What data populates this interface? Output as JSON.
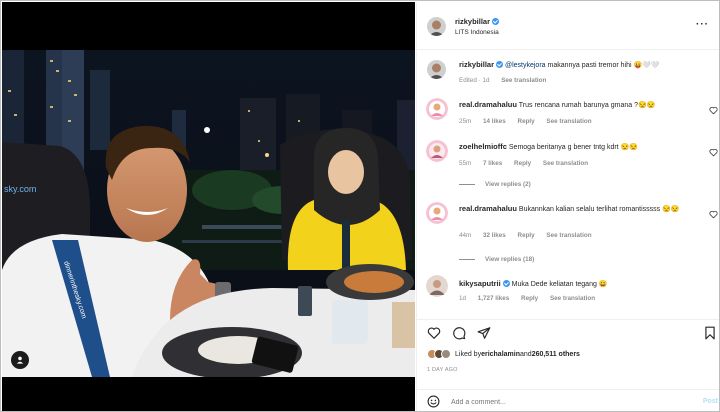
{
  "post": {
    "author": "rizkybillar",
    "location": "LITS Indonesia",
    "caption_mention": "@lestykejora",
    "caption_text": " makannya pasti tremor hihi 😛🤍🤍",
    "caption_time": "Edited · 1d",
    "see_translation": "See translation"
  },
  "photo": {
    "watermark": "sky.com",
    "lanyard_text": "dinnerinthesky.com"
  },
  "comments": [
    {
      "user": "real.dramahaluu",
      "text": "Trus rencana rumah barunya gmana ?😒😒",
      "time": "25m",
      "likes": "14 likes",
      "reply": "Reply",
      "translate": "See translation",
      "replies": ""
    },
    {
      "user": "zoelhelmioffc",
      "text": "Semoga beritanya g bener tntg kdrt 😒😒",
      "time": "55m",
      "likes": "7 likes",
      "reply": "Reply",
      "translate": "See translation",
      "replies": "View replies (2)"
    },
    {
      "user": "real.dramahaluu",
      "text": "Bukannkan kalian selalu terlihat romantisssss 😒😒",
      "time": "44m",
      "likes": "32 likes",
      "reply": "Reply",
      "translate": "See translation",
      "replies": "View replies (18)"
    },
    {
      "user": "kikysaputrii",
      "text": " Muka Dede keliatan tegang 😀",
      "time": "1d",
      "likes": "1,727 likes",
      "reply": "Reply",
      "translate": "See translation",
      "replies": ""
    }
  ],
  "likes_line": {
    "prefix": "Liked by ",
    "user": "erichalamin",
    "middle": " and ",
    "count": "260,511 others"
  },
  "date": "1 DAY AGO",
  "add_comment": {
    "placeholder": "Add a comment...",
    "post_label": "Post"
  },
  "colors": {
    "verified": "#3897f0",
    "post_button": "#b2dffc",
    "muted_text": "#8e8e8e",
    "sweater": "#f2d21a"
  },
  "icons": [
    "user-tag-icon",
    "verified-icon",
    "more-icon",
    "heart-icon",
    "comment-icon",
    "share-icon",
    "bookmark-icon",
    "emoji-icon"
  ]
}
